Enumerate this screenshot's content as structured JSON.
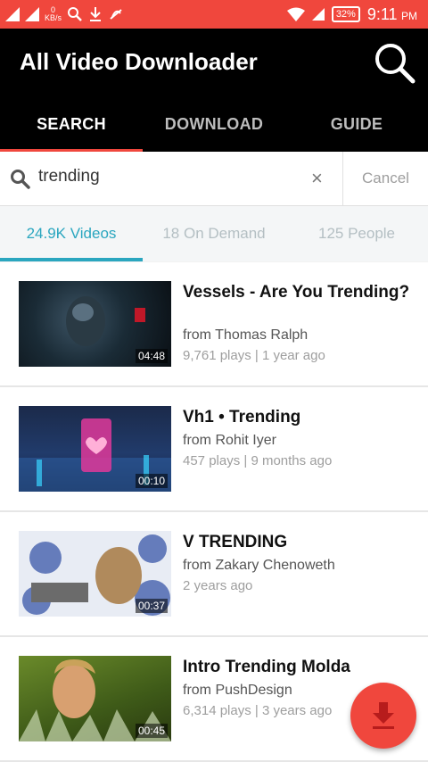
{
  "status_bar": {
    "net_speed_value": "0",
    "net_speed_unit": "KB/s",
    "battery": "32%",
    "time": "9:11",
    "ampm": "PM"
  },
  "app": {
    "title": "All Video Downloader",
    "tabs": [
      {
        "label": "SEARCH",
        "active": true
      },
      {
        "label": "DOWNLOAD",
        "active": false
      },
      {
        "label": "GUIDE",
        "active": false
      }
    ]
  },
  "search": {
    "query": "trending",
    "clear_symbol": "×",
    "cancel_label": "Cancel"
  },
  "filters": [
    {
      "label": "24.9K Videos",
      "active": true
    },
    {
      "label": "18 On Demand",
      "active": false
    },
    {
      "label": "125 People",
      "active": false
    }
  ],
  "results": [
    {
      "title": "Vessels - Are You Trending?",
      "author": "from Thomas Ralph",
      "meta": "9,761 plays | 1 year ago",
      "duration": "04:48"
    },
    {
      "title": "Vh1 • Trending",
      "author": "from Rohit Iyer",
      "meta": "457 plays | 9 months ago",
      "duration": "00:10"
    },
    {
      "title": "V TRENDING",
      "author": "from Zakary Chenoweth",
      "meta": "2 years ago",
      "duration": "00:37"
    },
    {
      "title": "Intro Trending Molda",
      "author": "from PushDesign",
      "meta": "6,314 plays | 3 years ago",
      "duration": "00:45"
    }
  ],
  "colors": {
    "accent_red": "#f0473d",
    "accent_teal": "#2aa6bf",
    "appbar_bg": "#000000"
  },
  "icons": {
    "fab": "download-icon",
    "appbar_search": "search-icon"
  }
}
